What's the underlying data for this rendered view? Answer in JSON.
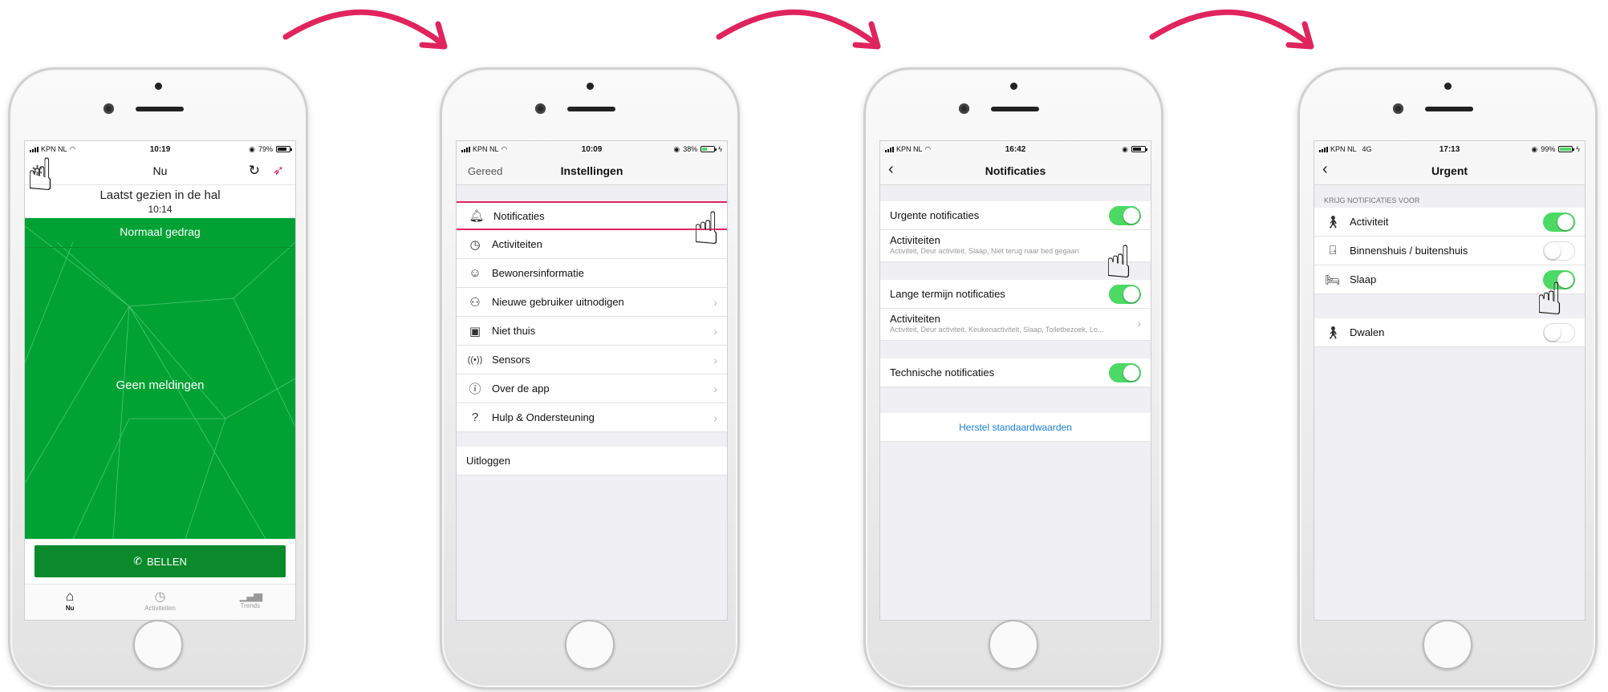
{
  "accent_pink": "#e0245e",
  "phone1": {
    "status": {
      "carrier": "KPN NL",
      "time": "10:19",
      "battery": "79%",
      "battery_level": 0.79
    },
    "nav_title": "Nu",
    "last_seen": "Laatst gezien in de hal",
    "last_seen_time": "10:14",
    "banner": "Normaal gedrag",
    "center_text": "Geen meldingen",
    "call_button": "BELLEN",
    "tabs": [
      {
        "label": "Nu",
        "icon": "home-icon"
      },
      {
        "label": "Activiteiten",
        "icon": "clock-icon"
      },
      {
        "label": "Trends",
        "icon": "bar-chart-icon"
      }
    ],
    "colors": {
      "green": "#00a234",
      "dark_green": "#0a8a2a"
    }
  },
  "phone2": {
    "status": {
      "carrier": "KPN NL",
      "time": "10:09",
      "battery": "38%",
      "battery_level": 0.38
    },
    "left_button": "Gereed",
    "nav_title": "Instellingen",
    "items": [
      {
        "label": "Notificaties",
        "icon": "bell-icon"
      },
      {
        "label": "Activiteiten",
        "icon": "clock-icon"
      },
      {
        "label": "Bewonersinformatie",
        "icon": "person-icon"
      },
      {
        "label": "Nieuwe gebruiker uitnodigen",
        "icon": "add-user-icon"
      },
      {
        "label": "Niet thuis",
        "icon": "suitcase-icon"
      },
      {
        "label": "Sensors",
        "icon": "sensor-icon"
      },
      {
        "label": "Over de app",
        "icon": "info-icon"
      },
      {
        "label": "Hulp & Ondersteuning",
        "icon": "help-icon"
      }
    ],
    "logout": "Uitloggen"
  },
  "phone3": {
    "status": {
      "carrier": "KPN NL",
      "time": "16:42"
    },
    "nav_title": "Notificaties",
    "urgent_label": "Urgente notificaties",
    "urgent_sub_title": "Activiteiten",
    "urgent_sub_desc": "Activiteit, Deur activiteit, Slaap, Niet terug naar bed gegaan",
    "long_label": "Lange termijn notificaties",
    "long_sub_title": "Activiteiten",
    "long_sub_desc": "Activiteit, Deur activiteit, Keukenactiviteit, Slaap, Toiletbezoek, Lo...",
    "tech_label": "Technische notificaties",
    "reset": "Herstel standaardwaarden",
    "link_color": "#1a7fe0"
  },
  "phone4": {
    "status": {
      "carrier": "KPN NL",
      "network": "4G",
      "time": "17:13",
      "battery": "99%",
      "battery_level": 0.99
    },
    "nav_title": "Urgent",
    "section_header": "KRIJG NOTIFICATIES VOOR",
    "items": [
      {
        "label": "Activiteit",
        "icon": "walking-icon",
        "on": true
      },
      {
        "label": "Binnenshuis / buitenshuis",
        "icon": "door-icon",
        "on": false
      },
      {
        "label": "Slaap",
        "icon": "bed-icon",
        "on": true
      }
    ],
    "wander": {
      "label": "Dwalen",
      "icon": "hiking-icon",
      "on": false
    }
  }
}
